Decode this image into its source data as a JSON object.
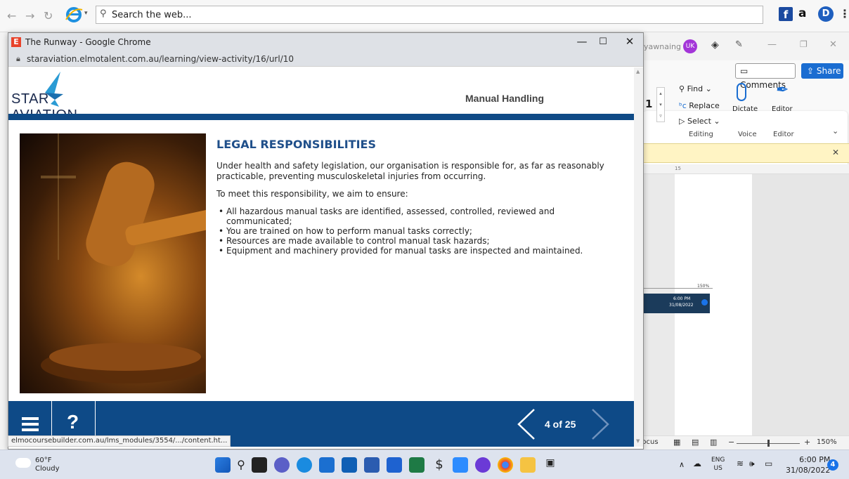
{
  "browser": {
    "search_placeholder": "Search the web...",
    "fb_label": "f",
    "amazon_label": "a",
    "more_label": "⋮"
  },
  "word": {
    "user_name": "yawnaing",
    "user_initials": "UK",
    "comments_label": "Comments",
    "share_label": "Share",
    "font_size_value": "1",
    "find_label": "Find",
    "replace_label": "Replace",
    "select_label": "Select",
    "editing_label": "Editing",
    "dictate_label": "Dictate",
    "voice_label": "Voice",
    "editor_label": "Editor",
    "editor_group_label": "Editor",
    "ruler_mark": "15",
    "mini_zoom": "150%",
    "mini_time": "6:00 PM",
    "mini_date": "31/08/2022",
    "status_focus": "Focus",
    "status_zoom": "150%"
  },
  "popup": {
    "title": "The Runway - Google Chrome",
    "url": "staraviation.elmotalent.com.au/learning/view-activity/16/url/10",
    "logo_text": "STAR AVIATION",
    "module_title": "Manual Handling",
    "heading": "LEGAL RESPONSIBILITIES",
    "intro": "Under health and safety legislation, our organisation is responsible for, as far as reasonably practicable, preventing musculoskeletal injuries from occurring.",
    "aim": "To meet this responsibility, we aim to ensure:",
    "bullets": [
      "All hazardous manual tasks are identified, assessed, controlled, reviewed and communicated;",
      "You are trained on how to perform manual tasks correctly;",
      "Resources are made available to control manual task hazards;",
      "Equipment and machinery provided for manual tasks are inspected and maintained."
    ],
    "page_count": "4 of 25",
    "help_label": "?",
    "status_link": "elmocoursebuilder.com.au/lms_modules/3554/.../content.ht..."
  },
  "taskbar": {
    "temperature": "60°F",
    "condition": "Cloudy",
    "lang_top": "ENG",
    "lang_bottom": "US",
    "time": "6:00 PM",
    "date": "31/08/2022",
    "notifications": "4"
  }
}
